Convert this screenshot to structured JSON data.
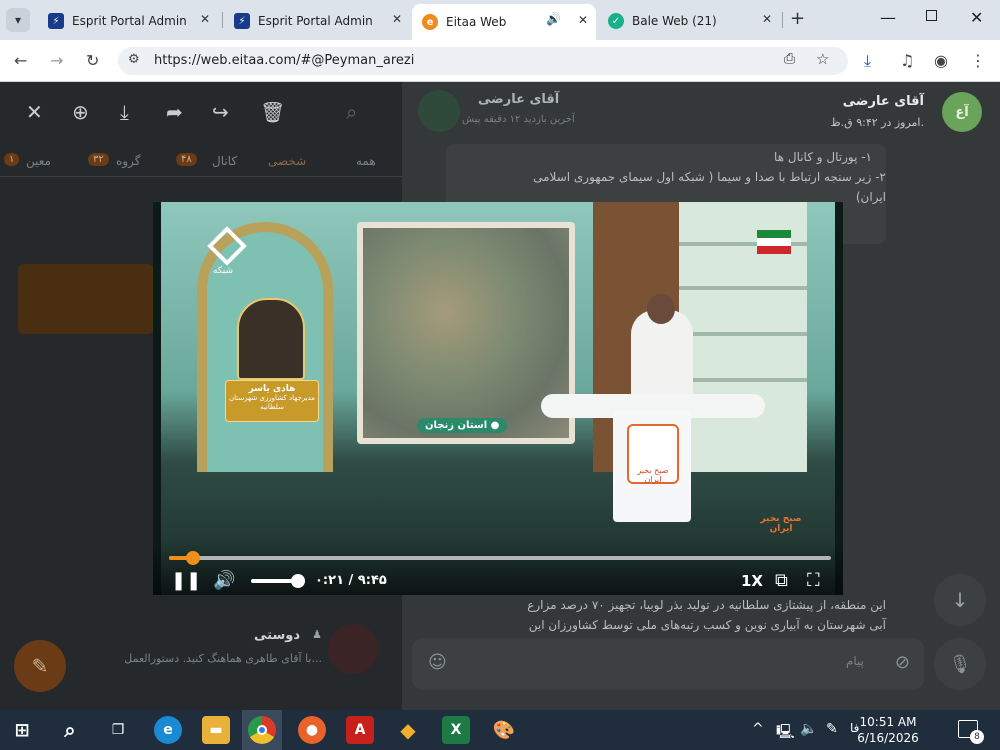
{
  "browser": {
    "tabs": [
      {
        "title": "Esprit Portal Admin",
        "favicon": "esprit-icon",
        "active": false
      },
      {
        "title": "Esprit Portal Admin",
        "favicon": "esprit-icon",
        "active": false
      },
      {
        "title": "Eitaa Web",
        "favicon": "eitaa-icon",
        "active": true,
        "audio": true
      },
      {
        "title": "Bale Web (21)",
        "favicon": "bale-icon",
        "active": false
      }
    ],
    "new_tab_symbol": "+",
    "url": "https://web.eitaa.com/#@Peyman_arezi"
  },
  "chat": {
    "contact_name": "آقای عارضی",
    "last_seen": "امروز در ۹:۴۲ ق.ظ.",
    "header_name_dim": "آقای عارضی",
    "header_sub_dim": "آخرین بازدید ۱۲ دقیقه پیش",
    "message_lines": [
      "۱- پورتال و کانال ها",
      "۲- زیر سنجه ارتباط با صدا و سیما ( شبکه اول سیمای جمهوری اسلامی",
      "ایران)"
    ],
    "bottom_lines": [
      "این منطقه، از پیشتازی سلطانیه در تولید بذر لوبیا، تجهیز ۷۰ درصد مزارع",
      "آبی شهرستان به آبیاری نوین و کسب رتبه‌های ملی توسط کشاورزان این"
    ],
    "input_placeholder": "پیام"
  },
  "sidebar": {
    "filters": [
      "همه",
      "شخصی",
      "کانال",
      "گروه",
      "معین"
    ],
    "filter_badges": [
      "",
      "",
      "۴۸",
      "۳۲",
      "۱"
    ],
    "items": [
      {
        "name": "دوستی",
        "preview": "با آقای طاهری هماهنگ کنید. دستورالعمل..."
      }
    ]
  },
  "player": {
    "time_current": "۰:۲۱",
    "time_total": "۹:۴۵",
    "time_separator": "/",
    "progress": 0.036,
    "volume": 0.9,
    "speed_label": "1X",
    "lower_third_name": "هادی یاسر",
    "lower_third_title": "مدیرجهاد کشاورزی شهرستان سلطانیه",
    "location_label": "استان زنجان",
    "network_label": "شبکه",
    "show_logo_text": "صبح بخیر ایران"
  },
  "taskbar": {
    "time": "10:51 AM",
    "date": "6/16/2026",
    "lang": "فا",
    "notifications": "8"
  },
  "colors": {
    "accent": "#ef8f1b",
    "taskbar_bg": "#1f2d3d",
    "tab_bg": "#dde3ea"
  }
}
